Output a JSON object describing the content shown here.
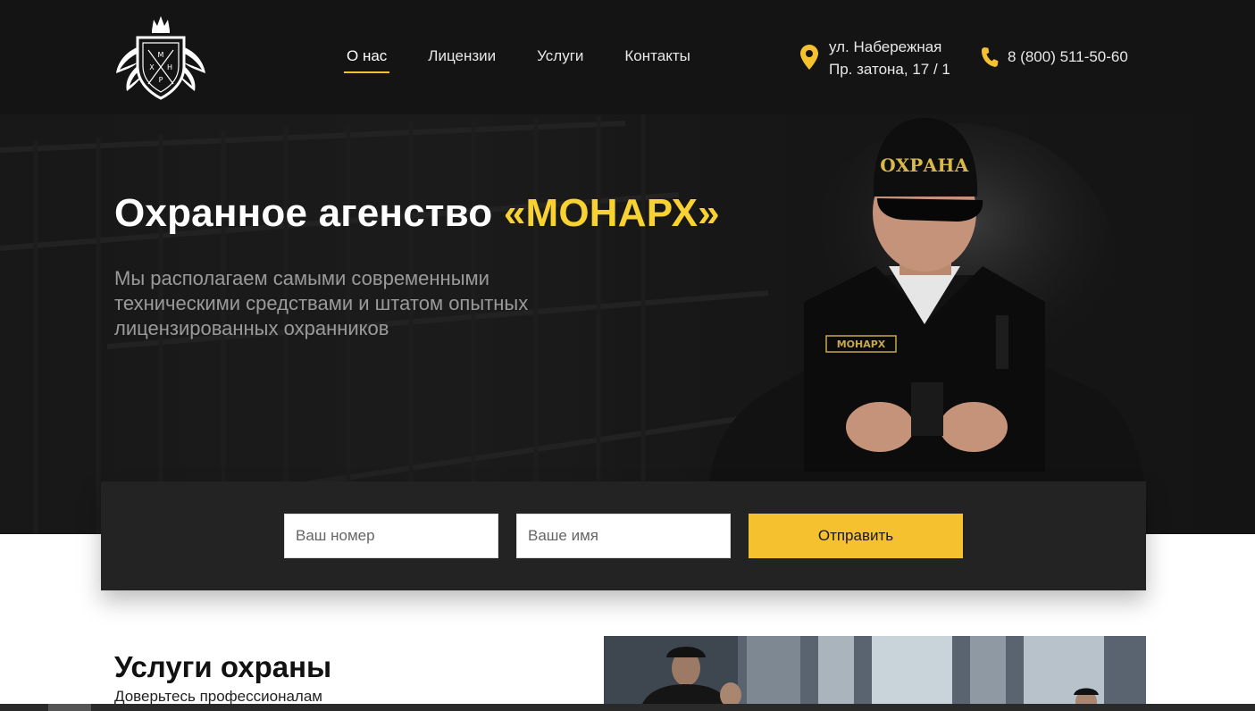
{
  "header": {
    "logo_letters": [
      "М",
      "Х",
      "Н",
      "Р"
    ],
    "nav": [
      {
        "label": "О нас",
        "active": true
      },
      {
        "label": "Лицензии",
        "active": false
      },
      {
        "label": "Услуги",
        "active": false
      },
      {
        "label": "Контакты",
        "active": false
      }
    ],
    "address_line1": "ул. Набережная",
    "address_line2": "Пр. затона, 17 / 1",
    "phone": "8 (800) 511-50-60"
  },
  "hero": {
    "title_main": "Охранное агенство ",
    "title_brand": "«МОНАРХ»",
    "subtitle": "Мы располагаем самыми современными техническими средствами и штатом опытных лицензированных охранников",
    "cap_text": "ОХРАНА",
    "patch_text": "МОНАРХ"
  },
  "form": {
    "phone_placeholder": "Ваш номер",
    "name_placeholder": "Ваше имя",
    "submit_label": "Отправить"
  },
  "services": {
    "title": "Услуги охраны",
    "subtitle": "Доверьтесь профессионалам"
  },
  "colors": {
    "accent": "#f5c12e",
    "brand_yellow": "#f7d232",
    "header_bg": "#141414",
    "form_bg": "#232323"
  }
}
